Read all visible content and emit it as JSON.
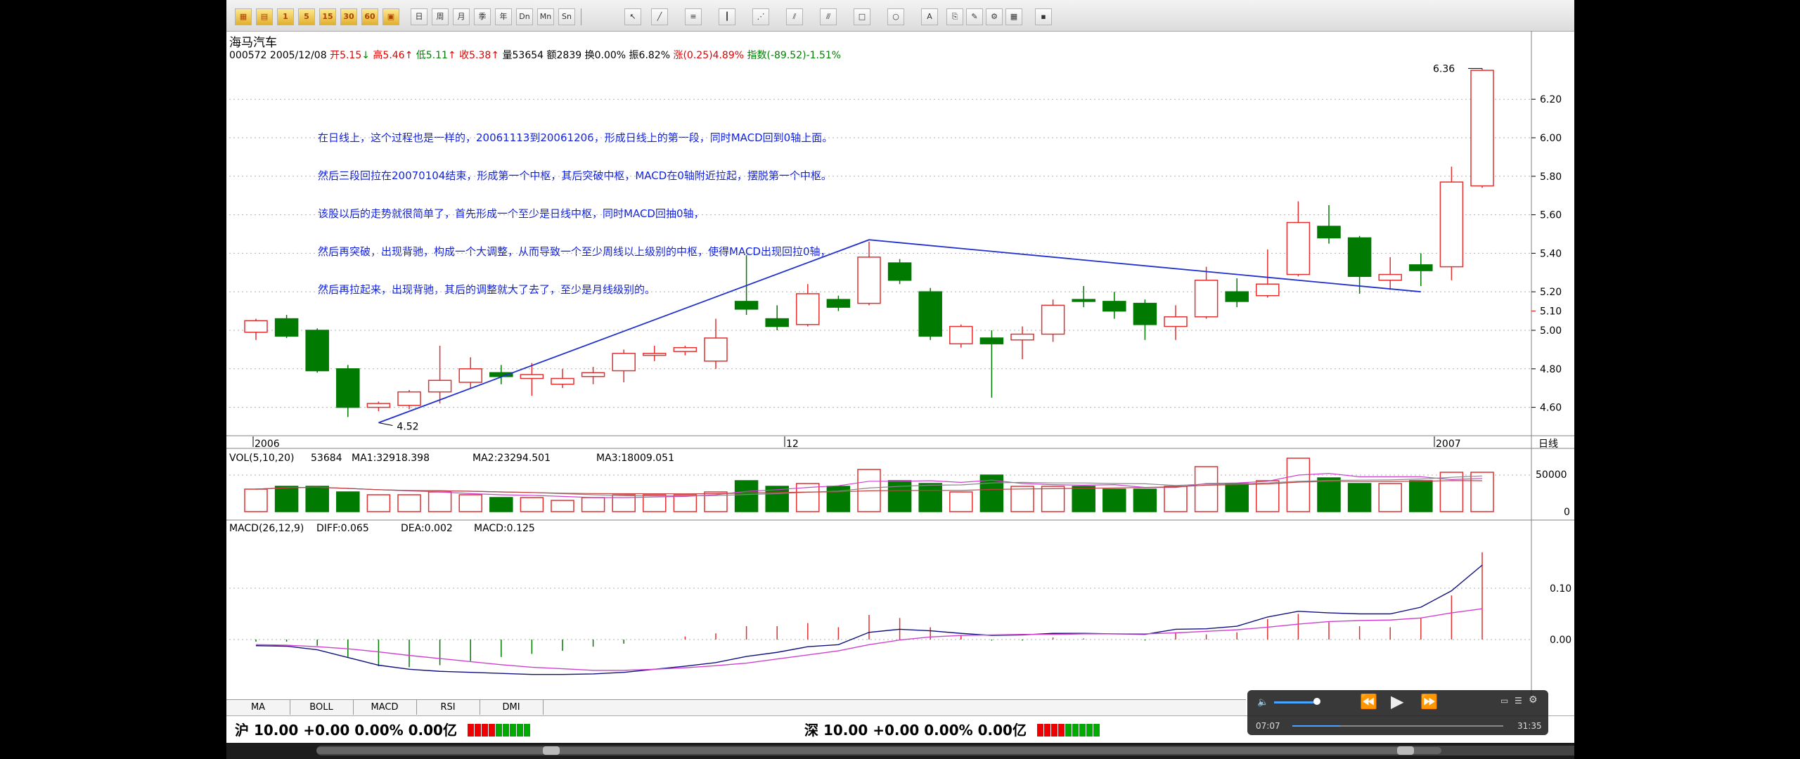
{
  "stock": {
    "name": "海马汽车",
    "code": "000572",
    "date": "2005/12/08",
    "open_label": "开",
    "open": "5.15",
    "high_label": "高",
    "high": "5.46",
    "low_label": "低",
    "low": "5.11",
    "close_label": "收",
    "close": "5.38",
    "vol_label": "量",
    "vol": "53654",
    "amount_label": "额",
    "amount": "2839",
    "turnover_label": "换",
    "turnover": "0.00%",
    "amplitude_label": "振",
    "amplitude": "6.82%",
    "change_label": "涨",
    "change": "(0.25)",
    "change_pct": "4.89%",
    "index_label": "指数",
    "index": "(-89.52)-1.51%"
  },
  "note_lines": [
    "在日线上，这个过程也是一样的，20061113到20061206，形成日线上的第一段，同时MACD回到0轴上面。",
    "然后三段回拉在20070104结束，形成第一个中枢，其后突破中枢，MACD在0轴附近拉起，摆脱第一个中枢。",
    "该股以后的走势就很简单了，首先形成一个至少是日线中枢，同时MACD回抽0轴，",
    "然后再突破，出现背驰，构成一个大调整，从而导致一个至少周线以上级别的中枢，使得MACD出现回拉0轴，",
    "然后再拉起来，出现背驰，其后的调整就大了去了，至少是月线级别的。"
  ],
  "price_axis": {
    "ticks": [
      "6.20",
      "6.00",
      "5.80",
      "5.60",
      "5.40",
      "5.20",
      "5.00",
      "4.80",
      "4.60"
    ],
    "tick_values": [
      6.2,
      6.0,
      5.8,
      5.6,
      5.4,
      5.2,
      5.0,
      4.8,
      4.6
    ],
    "current": "5.10",
    "max_label": "6.36",
    "min_label": "4.52"
  },
  "date_axis": {
    "labels": [
      "2006",
      "12",
      "2007"
    ],
    "mode": "日线"
  },
  "vol_panel": {
    "title": "VOL(5,10,20)",
    "value": "53684",
    "ma1": "MA1:32918.398",
    "ma2": "MA2:23294.501",
    "ma3": "MA3:18009.051",
    "ticks": [
      "50000",
      "0"
    ]
  },
  "macd_panel": {
    "title": "MACD(26,12,9)",
    "diff": "DIFF:0.065",
    "dea": "DEA:0.002",
    "macd": "MACD:0.125",
    "ticks": [
      "0.10",
      "0.00"
    ]
  },
  "candles": [
    [
      4.99,
      5.05,
      4.95,
      5.06
    ],
    [
      5.06,
      4.97,
      4.96,
      5.08
    ],
    [
      5.0,
      4.79,
      4.78,
      5.01
    ],
    [
      4.8,
      4.6,
      4.55,
      4.82
    ],
    [
      4.6,
      4.62,
      4.58,
      4.63
    ],
    [
      4.61,
      4.68,
      4.59,
      4.69
    ],
    [
      4.68,
      4.74,
      4.62,
      4.92
    ],
    [
      4.73,
      4.8,
      4.7,
      4.86
    ],
    [
      4.78,
      4.76,
      4.72,
      4.82
    ],
    [
      4.75,
      4.77,
      4.66,
      4.83
    ],
    [
      4.72,
      4.75,
      4.7,
      4.8
    ],
    [
      4.76,
      4.78,
      4.72,
      4.81
    ],
    [
      4.79,
      4.88,
      4.73,
      4.9
    ],
    [
      4.87,
      4.88,
      4.84,
      4.92
    ],
    [
      4.89,
      4.91,
      4.87,
      4.92
    ],
    [
      4.84,
      4.96,
      4.8,
      5.06
    ],
    [
      5.15,
      5.11,
      5.08,
      5.39
    ],
    [
      5.06,
      5.02,
      5.0,
      5.13
    ],
    [
      5.03,
      5.19,
      5.02,
      5.24
    ],
    [
      5.16,
      5.12,
      5.1,
      5.18
    ],
    [
      5.14,
      5.38,
      5.13,
      5.46
    ],
    [
      5.35,
      5.26,
      5.24,
      5.37
    ],
    [
      5.2,
      4.97,
      4.95,
      5.22
    ],
    [
      4.93,
      5.02,
      4.91,
      5.03
    ],
    [
      4.96,
      4.93,
      4.65,
      5.0
    ],
    [
      4.95,
      4.98,
      4.85,
      5.02
    ],
    [
      4.98,
      5.13,
      4.94,
      5.16
    ],
    [
      5.16,
      5.15,
      5.12,
      5.23
    ],
    [
      5.15,
      5.1,
      5.06,
      5.2
    ],
    [
      5.14,
      5.03,
      4.95,
      5.16
    ],
    [
      5.02,
      5.07,
      4.95,
      5.13
    ],
    [
      5.07,
      5.26,
      5.06,
      5.33
    ],
    [
      5.2,
      5.15,
      5.12,
      5.27
    ],
    [
      5.18,
      5.24,
      5.17,
      5.42
    ],
    [
      5.29,
      5.56,
      5.28,
      5.67
    ],
    [
      5.54,
      5.48,
      5.45,
      5.65
    ],
    [
      5.48,
      5.28,
      5.19,
      5.49
    ],
    [
      5.26,
      5.29,
      5.21,
      5.38
    ],
    [
      5.34,
      5.31,
      5.23,
      5.4
    ],
    [
      5.33,
      5.77,
      5.26,
      5.85
    ],
    [
      5.75,
      6.35,
      5.74,
      6.36
    ]
  ],
  "volumes": [
    8,
    9,
    9,
    7,
    6,
    6,
    7,
    6,
    5,
    5,
    4,
    5,
    6,
    6,
    6,
    7,
    11,
    9,
    10,
    9,
    15,
    11,
    10,
    7,
    13,
    9,
    9,
    9,
    8,
    8,
    9,
    16,
    10,
    11,
    19,
    12,
    10,
    10,
    11,
    14,
    14
  ],
  "diff": [
    -0.012,
    -0.013,
    -0.02,
    -0.035,
    -0.05,
    -0.058,
    -0.062,
    -0.064,
    -0.066,
    -0.068,
    -0.068,
    -0.067,
    -0.064,
    -0.058,
    -0.052,
    -0.045,
    -0.033,
    -0.025,
    -0.014,
    -0.01,
    0.014,
    0.02,
    0.017,
    0.012,
    0.008,
    0.009,
    0.012,
    0.012,
    0.011,
    0.01,
    0.02,
    0.021,
    0.026,
    0.044,
    0.055,
    0.052,
    0.05,
    0.05,
    0.063,
    0.095,
    0.145
  ],
  "dea": [
    -0.01,
    -0.011,
    -0.014,
    -0.018,
    -0.024,
    -0.031,
    -0.037,
    -0.043,
    -0.049,
    -0.054,
    -0.057,
    -0.06,
    -0.06,
    -0.058,
    -0.055,
    -0.051,
    -0.046,
    -0.038,
    -0.03,
    -0.022,
    -0.01,
    -0.001,
    0.005,
    0.008,
    0.009,
    0.01,
    0.01,
    0.011,
    0.011,
    0.011,
    0.013,
    0.016,
    0.019,
    0.024,
    0.03,
    0.035,
    0.037,
    0.038,
    0.042,
    0.052,
    0.06
  ],
  "tabs": [
    "MA",
    "BOLL",
    "MACD",
    "RSI",
    "DMI"
  ],
  "status": {
    "sh_label": "沪",
    "sh_value": "10.00 +0.00 0.00% 0.00亿",
    "sz_label": "深",
    "sz_value": "10.00 +0.00 0.00% 0.00亿"
  },
  "player": {
    "elapsed": "07:07",
    "total": "31:35"
  },
  "colors": {
    "up": "#e03030",
    "down": "#007a00",
    "line": "#2030d0",
    "ma2": "#d040d0"
  }
}
